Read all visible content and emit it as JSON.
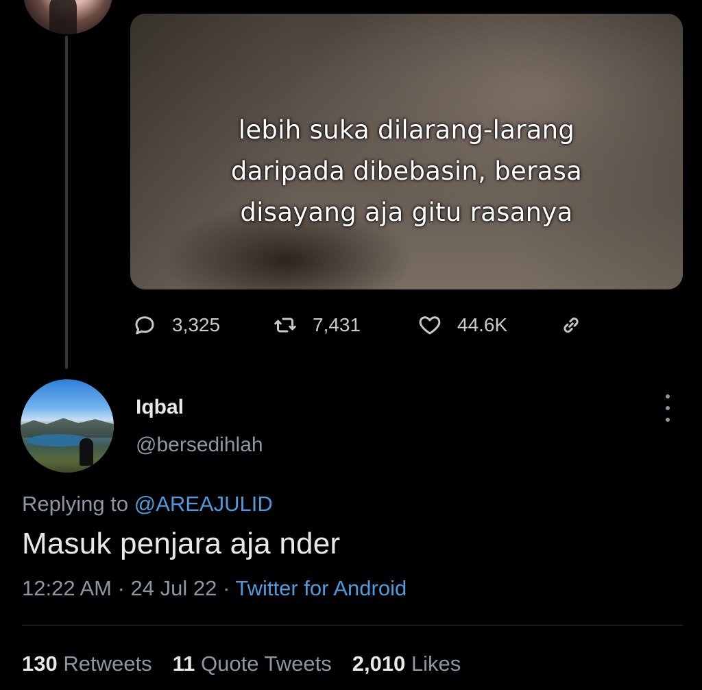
{
  "media": {
    "caption_lines": [
      "lebih suka dilarang-larang",
      "daripada dibebasin, berasa",
      "disayang aja gitu rasanya"
    ]
  },
  "actions": {
    "reply_count": "3,325",
    "retweet_count": "7,431",
    "like_count": "44.6K"
  },
  "reply": {
    "name": "Iqbal",
    "handle": "@bersedihlah",
    "replying_prefix": "Replying to ",
    "replying_to": "@AREAJULID",
    "text": "Masuk penjara aja nder",
    "time": "12:22 AM",
    "date": "24 Jul 22",
    "separator": " · ",
    "source": "Twitter for Android"
  },
  "stats": {
    "retweets_count": "130",
    "retweets_label": "Retweets",
    "quotes_count": "11",
    "quotes_label": "Quote Tweets",
    "likes_count": "2,010",
    "likes_label": "Likes"
  },
  "colors": {
    "background": "#000000",
    "link": "#4f9be0",
    "secondary_text": "#8b98a5"
  }
}
